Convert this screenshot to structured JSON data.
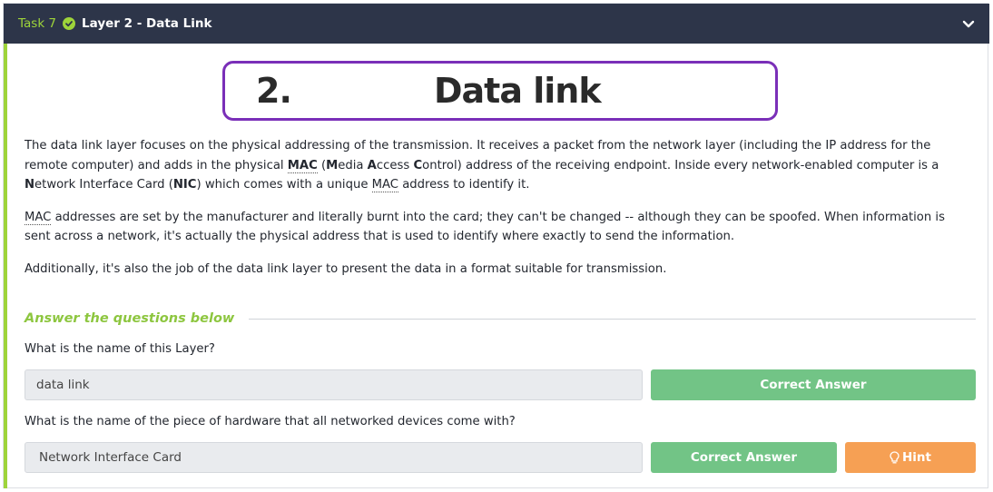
{
  "header": {
    "task_number": "Task 7",
    "title": "Layer 2 - Data Link",
    "status_icon": "check-circle-icon",
    "collapse_icon": "chevron-down-icon"
  },
  "banner": {
    "number": "2.",
    "text": "Data link"
  },
  "paragraphs": {
    "p1": {
      "a": "The data link layer focuses on the physical addressing of the transmission. It receives a packet from the network layer (including the IP address for the remote computer) and adds in the physical ",
      "mac": "MAC",
      "b": " (",
      "m": "M",
      "c": "edia ",
      "a2": "A",
      "d": "ccess ",
      "c2": "C",
      "e": "ontrol) address of the receiving endpoint. Inside every network-enabled computer is a ",
      "n": "N",
      "f": "etwork Interface Card (",
      "nic": "NIC",
      "g": ") which comes with a unique ",
      "mac2": "MAC",
      "h": " address to identify it."
    },
    "p2": {
      "mac": "MAC",
      "rest": " addresses are set by the manufacturer and literally burnt into the card; they can't be changed -- although they can be spoofed. When information is sent across a network, it's actually the physical address that is used to identify where exactly to send the information."
    },
    "p3": "Additionally, it's also the job of the data link layer to present the data in a format suitable for transmission."
  },
  "answers_heading": "Answer the questions below",
  "questions": [
    {
      "text": "What is the name of this Layer?",
      "answer": "data link",
      "button": "Correct Answer"
    },
    {
      "text": "What is the name of the piece of hardware that all networked devices come with?",
      "answer": "Network Interface Card",
      "button": "Correct Answer",
      "hint": "Hint"
    }
  ],
  "colors": {
    "header_bg": "#2d3549",
    "accent_green": "#9ed43a",
    "correct_button": "#72c486",
    "hint_button": "#f6a054",
    "banner_border": "#7a2fb8"
  }
}
